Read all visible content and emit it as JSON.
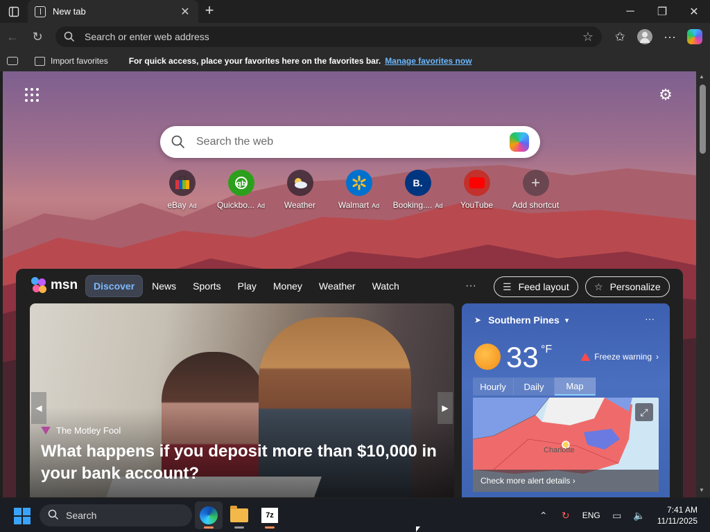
{
  "browser": {
    "tab_title": "New tab",
    "address_placeholder": "Search or enter web address"
  },
  "favbar": {
    "import_label": "Import favorites",
    "message": "For quick access, place your favorites here on the favorites bar.",
    "manage_link": "Manage favorites now"
  },
  "newtab": {
    "search_placeholder": "Search the web",
    "shortcuts": [
      {
        "label": "eBay",
        "ad": "Ad",
        "icon": "ebay-bag-icon",
        "color": "#e53238"
      },
      {
        "label": "Quickbo...",
        "ad": "Ad",
        "icon": "quickbooks-icon",
        "color": "#2ca01c"
      },
      {
        "label": "Weather",
        "ad": "",
        "icon": "weather-cloud-icon",
        "color": "#f2c94c"
      },
      {
        "label": "Walmart",
        "ad": "Ad",
        "icon": "walmart-spark-icon",
        "color": "#0071ce"
      },
      {
        "label": "Booking....",
        "ad": "Ad",
        "icon": "booking-icon",
        "color": "#003580"
      },
      {
        "label": "YouTube",
        "ad": "",
        "icon": "youtube-icon",
        "color": "#ff0000"
      },
      {
        "label": "Add shortcut",
        "ad": "",
        "icon": "plus-icon",
        "color": "#cccccc"
      }
    ],
    "booking_letter": "B."
  },
  "feed": {
    "brand": "msn",
    "nav": [
      "Discover",
      "News",
      "Sports",
      "Play",
      "Money",
      "Weather",
      "Watch"
    ],
    "more": "···",
    "feed_layout": "Feed layout",
    "personalize": "Personalize",
    "hero": {
      "source": "The Motley Fool",
      "title": "What happens if you deposit more than $10,000 in your bank account?"
    },
    "weather": {
      "location": "Southern Pines",
      "temperature": "33",
      "unit": "°F",
      "alert": "Freeze warning",
      "tabs": [
        "Hourly",
        "Daily",
        "Map"
      ],
      "active_tab": "Map",
      "map_city": "Charlotte",
      "map_link": "Check more alert details"
    }
  },
  "taskbar": {
    "search_label": "Search",
    "app_7z": "7z",
    "language": "ENG",
    "time": "7:41 AM",
    "date": "11/11/2025"
  }
}
